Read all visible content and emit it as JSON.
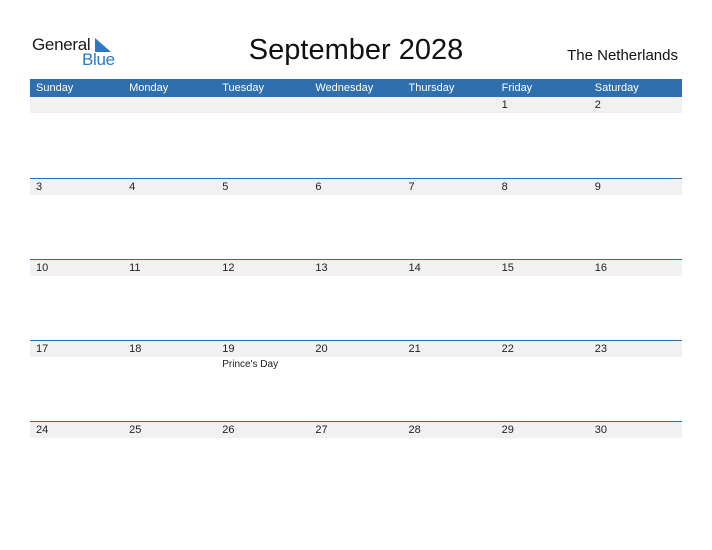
{
  "logo": {
    "word1": "General",
    "word2": "Blue"
  },
  "title": "September 2028",
  "country": "The Netherlands",
  "colors": {
    "header_bg": "#2f6fad",
    "accent": "#2a7bc4",
    "strip_bg": "#f1f1f1"
  },
  "weekdays": [
    "Sunday",
    "Monday",
    "Tuesday",
    "Wednesday",
    "Thursday",
    "Friday",
    "Saturday"
  ],
  "weeks": [
    {
      "days": [
        "",
        "",
        "",
        "",
        "",
        "1",
        "2"
      ],
      "holidays": [
        "",
        "",
        "",
        "",
        "",
        "",
        ""
      ]
    },
    {
      "days": [
        "3",
        "4",
        "5",
        "6",
        "7",
        "8",
        "9"
      ],
      "holidays": [
        "",
        "",
        "",
        "",
        "",
        "",
        ""
      ]
    },
    {
      "days": [
        "10",
        "11",
        "12",
        "13",
        "14",
        "15",
        "16"
      ],
      "holidays": [
        "",
        "",
        "",
        "",
        "",
        "",
        ""
      ]
    },
    {
      "days": [
        "17",
        "18",
        "19",
        "20",
        "21",
        "22",
        "23"
      ],
      "holidays": [
        "",
        "",
        "Prince's Day",
        "",
        "",
        "",
        ""
      ]
    },
    {
      "days": [
        "24",
        "25",
        "26",
        "27",
        "28",
        "29",
        "30"
      ],
      "holidays": [
        "",
        "",
        "",
        "",
        "",
        "",
        ""
      ]
    }
  ]
}
